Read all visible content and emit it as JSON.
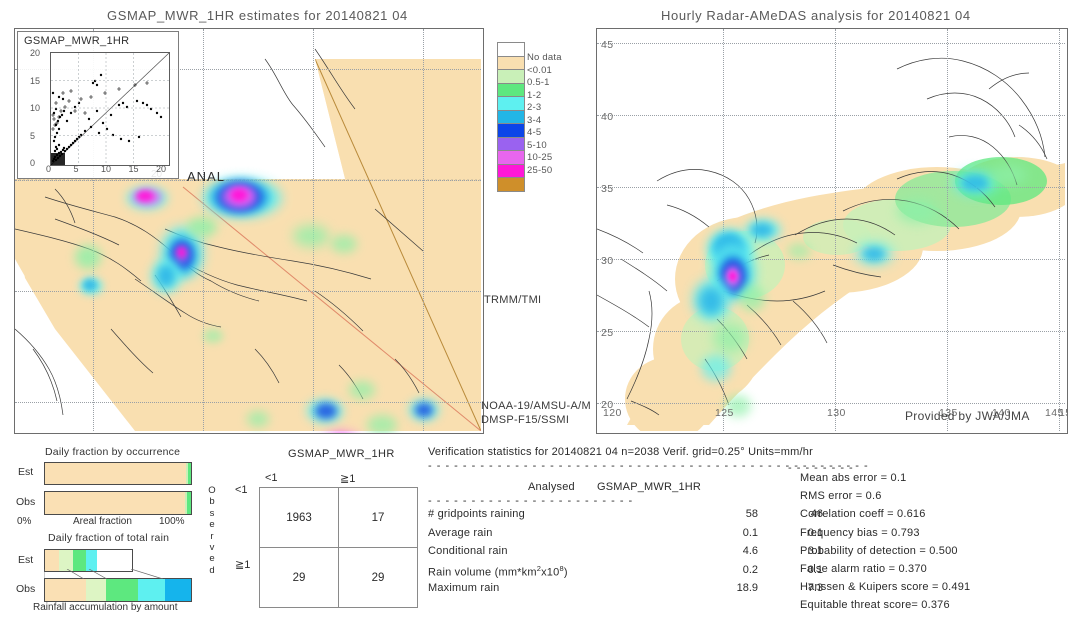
{
  "left_panel": {
    "title": "GSMAP_MWR_1HR estimates for 20140821 04",
    "inset_title": "GSMAP_MWR_1HR",
    "inset_yticks": [
      "20",
      "15",
      "10",
      "5",
      "0"
    ],
    "inset_xticks": [
      "0",
      "5",
      "10",
      "15",
      "20"
    ],
    "anal_label": "ANAL",
    "sat_labels": [
      "TRMM/TMI",
      "NOAA-19/AMSU-A/M",
      "DMSP-F15/SSMI"
    ]
  },
  "right_panel": {
    "title": "Hourly Radar-AMeDAS analysis for 20140821 04",
    "credit": "Provided by JWA/JMA",
    "lon_ticks": [
      "120",
      "125",
      "130",
      "135",
      "140",
      "145",
      "15"
    ],
    "lat_ticks": [
      "45",
      "40",
      "35",
      "30",
      "25",
      "20"
    ]
  },
  "colorbar": {
    "labels": [
      "No data",
      "<0.01",
      "0.5-1",
      "1-2",
      "2-3",
      "3-4",
      "4-5",
      "5-10",
      "10-25",
      "25-50"
    ],
    "colors": [
      "#ffffff",
      "#f9dfb0",
      "#c9f0b8",
      "#5de87f",
      "#5ef0f0",
      "#23b6e6",
      "#0c45e8",
      "#9a62f0",
      "#e866ee",
      "#ff17d8",
      "#cf8f2a"
    ]
  },
  "fraction_occurrence": {
    "title": "Daily fraction by occurrence",
    "row_labels": [
      "Est",
      "Obs"
    ],
    "axis_left": "0%",
    "axis_center": "Areal fraction",
    "axis_right": "100%",
    "est_segments": [
      {
        "color": "#fae0b4",
        "pct": 96.8
      },
      {
        "color": "#c9f0b8",
        "pct": 1.4
      },
      {
        "color": "#5de87f",
        "pct": 1.8
      }
    ],
    "obs_segments": [
      {
        "color": "#fae0b4",
        "pct": 96.0
      },
      {
        "color": "#c9f0b8",
        "pct": 1.6
      },
      {
        "color": "#5de87f",
        "pct": 2.4
      }
    ]
  },
  "fraction_amount": {
    "title": "Daily fraction of total rain",
    "caption": "Rainfall accumulation by amount",
    "row_labels": [
      "Est",
      "Obs"
    ],
    "est_segments": [
      {
        "color": "#fae0b4",
        "pct": 16
      },
      {
        "color": "#ddf5c4",
        "pct": 16
      },
      {
        "color": "#5de87f",
        "pct": 15
      },
      {
        "color": "#5ef0f0",
        "pct": 13
      }
    ],
    "obs_segments": [
      {
        "color": "#fae0b4",
        "pct": 28
      },
      {
        "color": "#ddf5c4",
        "pct": 14
      },
      {
        "color": "#5de87f",
        "pct": 22
      },
      {
        "color": "#5ef0f0",
        "pct": 18
      },
      {
        "color": "#15b4ec",
        "pct": 18
      }
    ]
  },
  "contingency": {
    "title": "GSMAP_MWR_1HR",
    "col_headers": [
      "<1",
      "≧1"
    ],
    "row_headers": [
      "<1",
      "≧1"
    ],
    "vertical_label": "Observed",
    "cells": [
      [
        "1963",
        "17"
      ],
      [
        "29",
        "29"
      ]
    ]
  },
  "verification": {
    "header": "Verification statistics for 20140821 04   n=2038   Verif. grid=0.25°   Units=mm/hr",
    "col_head_analysed": "Analysed",
    "col_head_model": "GSMAP_MWR_1HR",
    "rows": [
      {
        "label": "# gridpoints raining",
        "analysed": "58",
        "model": "46"
      },
      {
        "label": "Average rain",
        "analysed": "0.1",
        "model": "0.1"
      },
      {
        "label": "Conditional rain",
        "analysed": "4.6",
        "model": "3.1"
      },
      {
        "label": "Rain volume (mm*km²x10⁸)",
        "analysed": "0.2",
        "model": "0.1"
      },
      {
        "label": "Maximum rain",
        "analysed": "18.9",
        "model": "7.3"
      }
    ],
    "scores": [
      "Mean abs error = 0.1",
      "RMS error = 0.6",
      "Correlation coeff = 0.616",
      "Frequency bias = 0.793",
      "Probability of detection = 0.500",
      "False alarm ratio = 0.370",
      "Hanssen & Kuipers score = 0.491",
      "Equitable threat score= 0.376"
    ]
  },
  "chart_data": {
    "type": "heatmap",
    "title": "GSMAP_MWR_1HR estimates vs Hourly Radar-AMeDAS analysis for 20140821 04",
    "units": "mm/hr",
    "n": 2038,
    "verif_grid_deg": 0.25,
    "colorbar_bins": [
      "No data",
      "<0.01",
      "0.5-1",
      "1-2",
      "2-3",
      "3-4",
      "4-5",
      "5-10",
      "10-25",
      "25-50"
    ],
    "lon_range": [
      118,
      150
    ],
    "lat_range": [
      19,
      47
    ],
    "contingency_matrix": [
      [
        1963,
        17
      ],
      [
        29,
        29
      ]
    ],
    "statistics": {
      "gridpoints_raining": {
        "analysed": 58,
        "model": 46
      },
      "average_rain": {
        "analysed": 0.1,
        "model": 0.1
      },
      "conditional_rain": {
        "analysed": 4.6,
        "model": 3.1
      },
      "rain_volume": {
        "analysed": 0.2,
        "model": 0.1
      },
      "maximum_rain": {
        "analysed": 18.9,
        "model": 7.3
      },
      "mean_abs_error": 0.1,
      "rms_error": 0.6,
      "correlation_coeff": 0.616,
      "frequency_bias": 0.793,
      "probability_of_detection": 0.5,
      "false_alarm_ratio": 0.37,
      "hanssen_kuipers_score": 0.491,
      "equitable_threat_score": 0.376
    }
  }
}
